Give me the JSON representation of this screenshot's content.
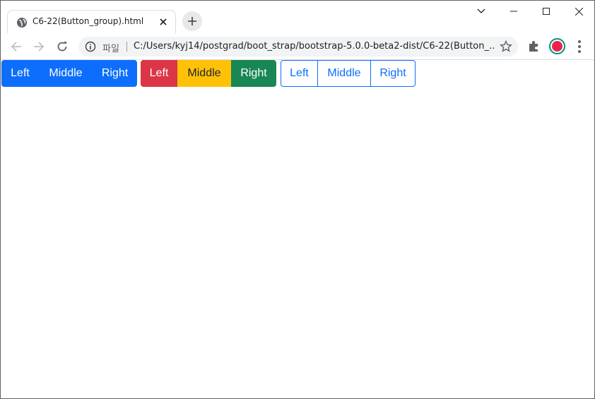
{
  "browser": {
    "tab": {
      "title": "C6-22(Button_group).html",
      "favicon": "globe-icon"
    },
    "window_controls": [
      "chevron-down-icon",
      "minimize-icon",
      "maximize-icon",
      "close-icon"
    ],
    "omnibox": {
      "scheme_label": "파일",
      "url": "C:/Users/kyj14/postgrad/boot_strap/bootstrap-5.0.0-beta2-dist/C6-22(Button_..."
    }
  },
  "page": {
    "groups": [
      {
        "style": "primary",
        "buttons": [
          "Left",
          "Middle",
          "Right"
        ]
      },
      {
        "style": "mixed",
        "buttons": [
          "Left",
          "Middle",
          "Right"
        ]
      },
      {
        "style": "outline-primary",
        "buttons": [
          "Left",
          "Middle",
          "Right"
        ]
      }
    ]
  },
  "colors": {
    "primary": "#0d6efd",
    "danger": "#dc3545",
    "warning": "#ffc107",
    "success": "#198754"
  }
}
